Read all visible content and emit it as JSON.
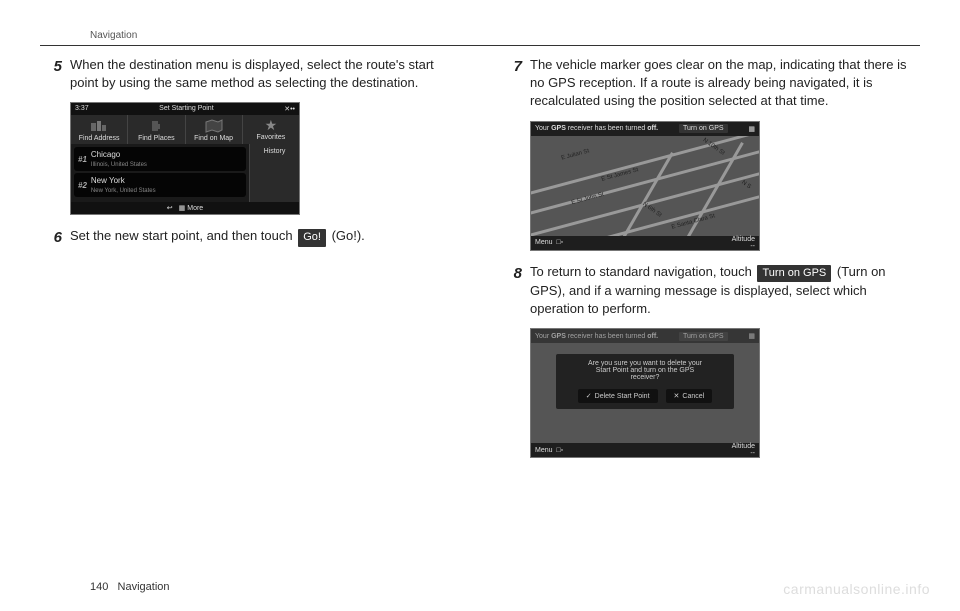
{
  "header": {
    "section": "Navigation"
  },
  "steps": {
    "s5": {
      "num": "5",
      "text": "When the destination menu is displayed, select the route's start point by using the same method as selecting the destination."
    },
    "s6": {
      "num": "6",
      "text_pre": "Set the new start point, and then touch ",
      "btn": "Go!",
      "text_post": " (Go!)."
    },
    "s7": {
      "num": "7",
      "text": "The vehicle marker goes clear on the map, indicating that there is no GPS reception. If a route is already being navigated, it is recalculated using the position selected at that time."
    },
    "s8": {
      "num": "8",
      "text_pre": "To return to standard navigation, touch ",
      "btn": "Turn on GPS",
      "text_post": " (Turn on GPS), and if a warning message is displayed, select which operation to perform."
    }
  },
  "shot1": {
    "time": "3:37",
    "title": "Set Starting Point",
    "tabs": {
      "a": "Find Address",
      "b": "Find Places",
      "c": "Find on Map",
      "d": "Favorites"
    },
    "history": "History",
    "items": [
      {
        "rank": "#1",
        "name": "Chicago",
        "sub": "Illinois, United States"
      },
      {
        "rank": "#2",
        "name": "New York",
        "sub": "New York, United States"
      }
    ],
    "more": "More",
    "back": "↩"
  },
  "shot2": {
    "banner_pre": "Your ",
    "banner_bold": "GPS",
    "banner_mid": " receiver has been turned ",
    "banner_bold2": "off.",
    "turn_on": "Turn on GPS",
    "menu": "Menu",
    "altitude_label": "Altitude",
    "altitude_value": "--",
    "streets": [
      "E Julian St",
      "E St James St",
      "E St John St",
      "N 6th St",
      "N 10th St",
      "E Santa Clara St",
      "N S"
    ]
  },
  "shot3": {
    "dialog_l1": "Are you sure you want to delete your",
    "dialog_l2": "Start Point and turn on the GPS",
    "dialog_l3": "receiver?",
    "btn_delete": "Delete Start Point",
    "btn_cancel": "Cancel"
  },
  "footer": {
    "page": "140",
    "section": "Navigation"
  },
  "watermark": "carmanualsonline.info"
}
